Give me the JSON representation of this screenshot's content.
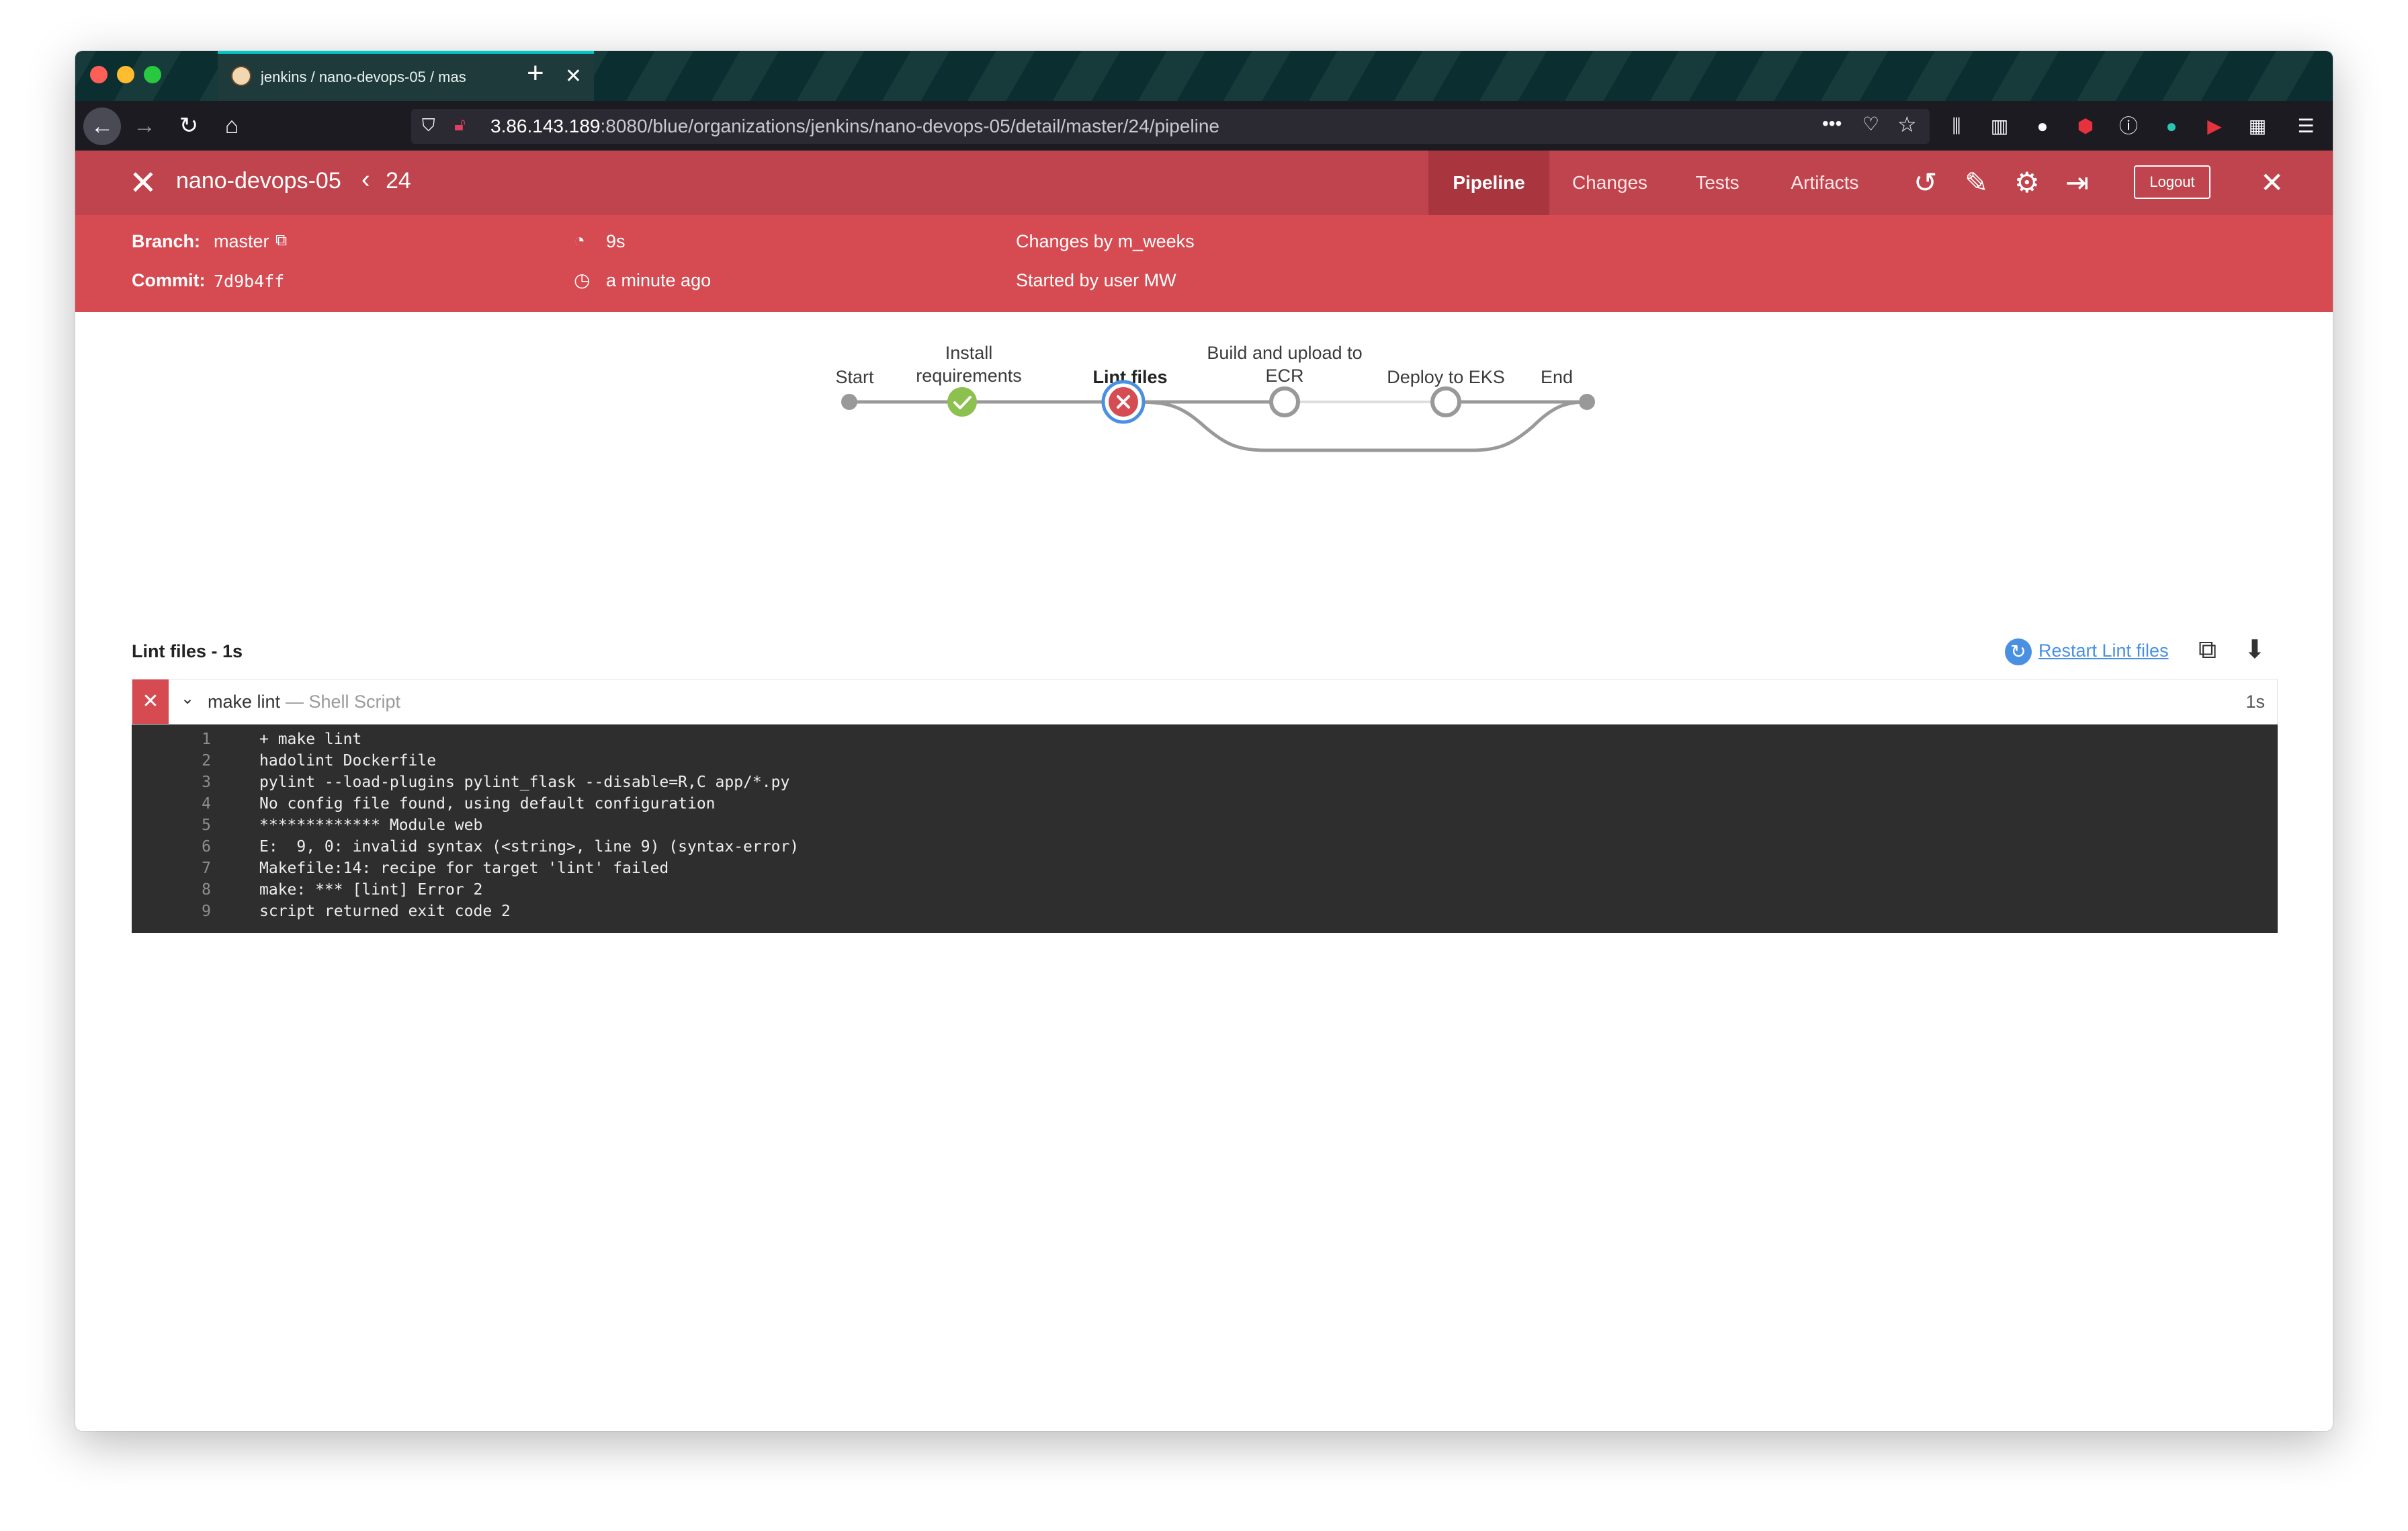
{
  "browser": {
    "tab_title": "jenkins / nano-devops-05 / mas",
    "new_tab": "+",
    "url_host": "3.86.143.189",
    "url_rest": ":8080/blue/organizations/jenkins/nano-devops-05/detail/master/24/pipeline",
    "menu_dots": "•••"
  },
  "header": {
    "project": "nano-devops-05",
    "run_number": "24",
    "tabs": [
      {
        "label": "Pipeline",
        "active": true
      },
      {
        "label": "Changes",
        "active": false
      },
      {
        "label": "Tests",
        "active": false
      },
      {
        "label": "Artifacts",
        "active": false
      }
    ],
    "logout": "Logout"
  },
  "run": {
    "branch_label": "Branch:",
    "branch": "master",
    "commit_label": "Commit:",
    "commit": "7d9b4ff",
    "duration": "9s",
    "time_ago": "a minute ago",
    "changes": "Changes by m_weeks",
    "started": "Started by user MW"
  },
  "stages": [
    {
      "name": "Start",
      "status": "start"
    },
    {
      "name": "Install requirements",
      "status": "success"
    },
    {
      "name": "Lint files",
      "status": "failed",
      "selected": true
    },
    {
      "name": "Build and upload to ECR",
      "status": "not-built",
      "parallel": true
    },
    {
      "name": "Deploy to EKS",
      "status": "not-built",
      "parallel": true
    },
    {
      "name": "End",
      "status": "end"
    }
  ],
  "step": {
    "title": "Lint files - 1s",
    "restart": "Restart Lint files",
    "name": "make lint",
    "description": "— Shell Script",
    "duration": "1s",
    "log": [
      "+ make lint",
      "hadolint Dockerfile",
      "pylint --load-plugins pylint_flask --disable=R,C app/*.py",
      "No config file found, using default configuration",
      "************* Module web",
      "E:  9, 0: invalid syntax (<string>, line 9) (syntax-error)",
      "Makefile:14: recipe for target 'lint' failed",
      "make: *** [lint] Error 2",
      "script returned exit code 2"
    ]
  },
  "colors": {
    "header": "#c0444d",
    "info_bar": "#d64a51",
    "success": "#8cc04f",
    "failure": "#d54c53",
    "selected_ring": "#4a90e2",
    "link": "#4a90e2"
  }
}
